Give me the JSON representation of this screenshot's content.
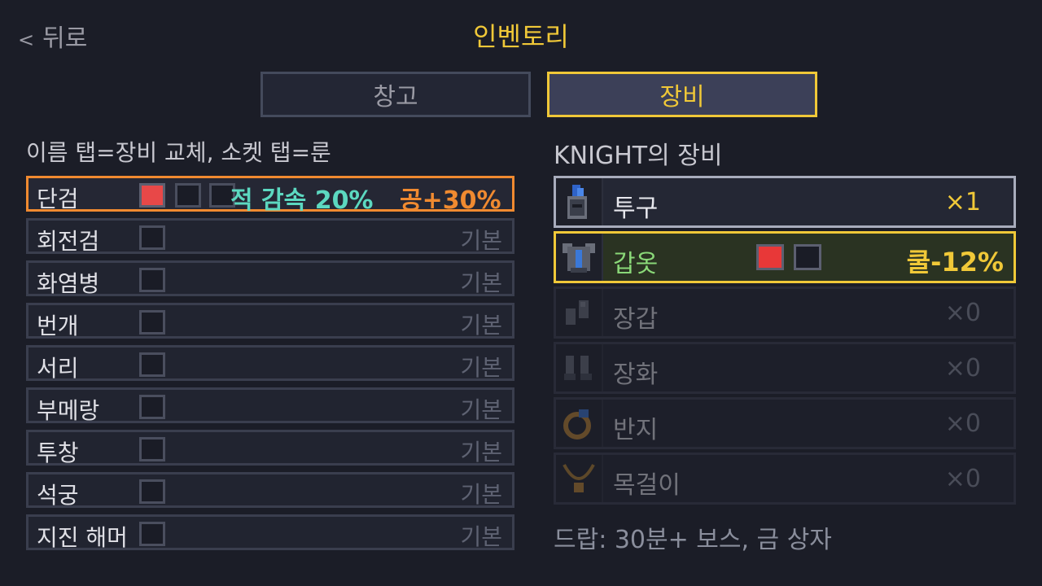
{
  "header": {
    "back_label": "뒤로",
    "title": "인벤토리"
  },
  "tabs": [
    {
      "label": "창고",
      "active": false
    },
    {
      "label": "장비",
      "active": true
    }
  ],
  "left": {
    "hint": "이름 탭=장비 교체, 소켓 탭=룬",
    "weapons": [
      {
        "name": "단검",
        "sockets": [
          "red",
          "empty",
          "empty"
        ],
        "selected": true,
        "effects": [
          {
            "text": "적 감속 20%",
            "color": "#5cd8c0"
          },
          {
            "text": "공+30%",
            "color": "#f08a30"
          }
        ]
      },
      {
        "name": "회전검",
        "sockets": [
          "empty"
        ],
        "tag": "기본"
      },
      {
        "name": "화염병",
        "sockets": [
          "empty"
        ],
        "tag": "기본"
      },
      {
        "name": "번개",
        "sockets": [
          "empty"
        ],
        "tag": "기본"
      },
      {
        "name": "서리",
        "sockets": [
          "empty"
        ],
        "tag": "기본"
      },
      {
        "name": "부메랑",
        "sockets": [
          "empty"
        ],
        "tag": "기본"
      },
      {
        "name": "투창",
        "sockets": [
          "empty"
        ],
        "tag": "기본"
      },
      {
        "name": "석궁",
        "sockets": [
          "empty"
        ],
        "tag": "기본"
      },
      {
        "name": "지진 해머",
        "sockets": [
          "empty"
        ],
        "tag": "기본"
      }
    ]
  },
  "right": {
    "title": "KNIGHT의 장비",
    "slots": [
      {
        "name": "투구",
        "count": "×1",
        "state": "head",
        "icon": "helmet-icon"
      },
      {
        "name": "갑옷",
        "bonus": "쿨-12%",
        "sockets": [
          "red",
          "empty"
        ],
        "state": "chest",
        "icon": "armor-icon"
      },
      {
        "name": "장갑",
        "count": "×0",
        "state": "empty",
        "icon": "gloves-icon"
      },
      {
        "name": "장화",
        "count": "×0",
        "state": "empty",
        "icon": "boots-icon"
      },
      {
        "name": "반지",
        "count": "×0",
        "state": "empty",
        "icon": "ring-icon"
      },
      {
        "name": "목걸이",
        "count": "×0",
        "state": "empty",
        "icon": "necklace-icon"
      }
    ],
    "drop_text": "드랍: 30분+ 보스, 금 상자"
  }
}
